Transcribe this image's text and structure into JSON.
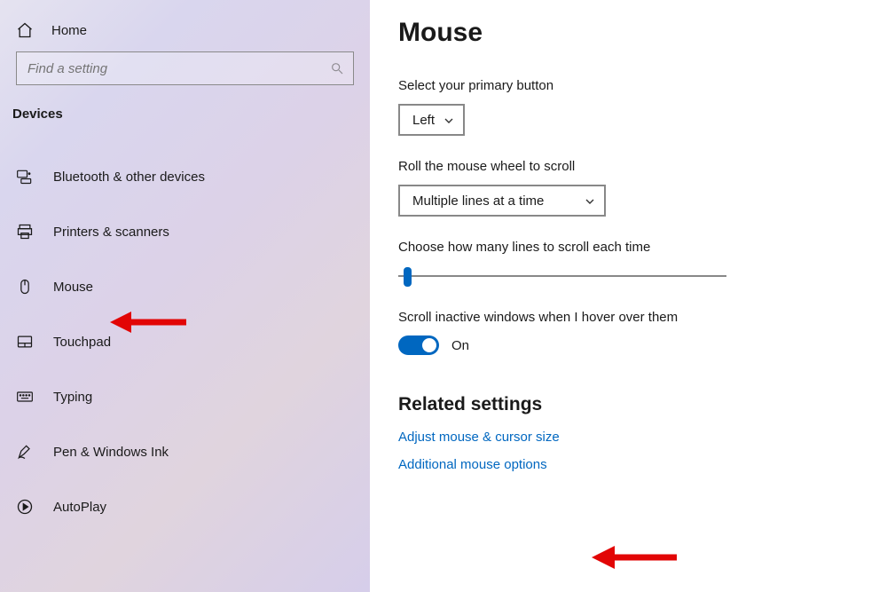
{
  "sidebar": {
    "home_label": "Home",
    "search_placeholder": "Find a setting",
    "section_title": "Devices",
    "items": [
      {
        "label": "Bluetooth & other devices"
      },
      {
        "label": "Printers & scanners"
      },
      {
        "label": "Mouse"
      },
      {
        "label": "Touchpad"
      },
      {
        "label": "Typing"
      },
      {
        "label": "Pen & Windows Ink"
      },
      {
        "label": "AutoPlay"
      }
    ]
  },
  "main": {
    "title": "Mouse",
    "primary_button_label": "Select your primary button",
    "primary_button_value": "Left",
    "wheel_label": "Roll the mouse wheel to scroll",
    "wheel_value": "Multiple lines at a time",
    "lines_label": "Choose how many lines to scroll each time",
    "inactive_label": "Scroll inactive windows when I hover over them",
    "inactive_value": "On",
    "related_heading": "Related settings",
    "link1": "Adjust mouse & cursor size",
    "link2": "Additional mouse options"
  }
}
